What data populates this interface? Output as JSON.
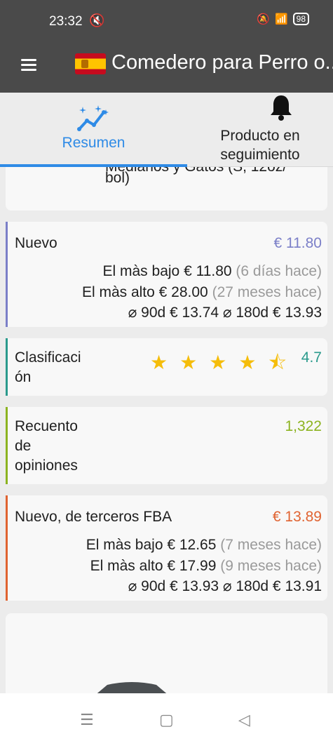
{
  "status": {
    "time": "23:32",
    "battery": "98"
  },
  "appbar": {
    "title": "Comedero para Perro o..."
  },
  "tabs": [
    {
      "label": "Resumen"
    },
    {
      "label": "Producto en seguimiento"
    }
  ],
  "top_card": {
    "text_line1": "Medianos y Gatos (S, 12oz/",
    "text_line2": "bol)"
  },
  "nuevo": {
    "label": "Nuevo",
    "price": "€ 11.80",
    "color": "#7b7fc8",
    "low_label": "El màs bajo",
    "low_price": "€ 11.80",
    "low_time": "(6 días hace)",
    "high_label": "El màs alto",
    "high_price": "€ 28.00",
    "high_time": "(27 meses hace)",
    "avg": "⌀ 90d € 13.74 ⌀ 180d € 13.93"
  },
  "rating": {
    "label_line1": "Clasificaci",
    "label_line2": "ón",
    "value": "4.7",
    "stars": 4.5,
    "color": "#2a9a8c"
  },
  "reviews": {
    "label_line1": "Recuento",
    "label_line2": "de",
    "label_line3": "opiniones",
    "value": "1,322",
    "color": "#8cb320"
  },
  "fba": {
    "label": "Nuevo, de terceros FBA",
    "price": "€ 13.89",
    "color": "#e06331",
    "low_label": "El màs bajo",
    "low_price": "€ 12.65",
    "low_time": "(7 meses hace)",
    "high_label": "El màs alto",
    "high_price": "€ 17.99",
    "high_time": "(9 meses hace)",
    "avg": "⌀ 90d € 13.93 ⌀ 180d € 13.91"
  }
}
